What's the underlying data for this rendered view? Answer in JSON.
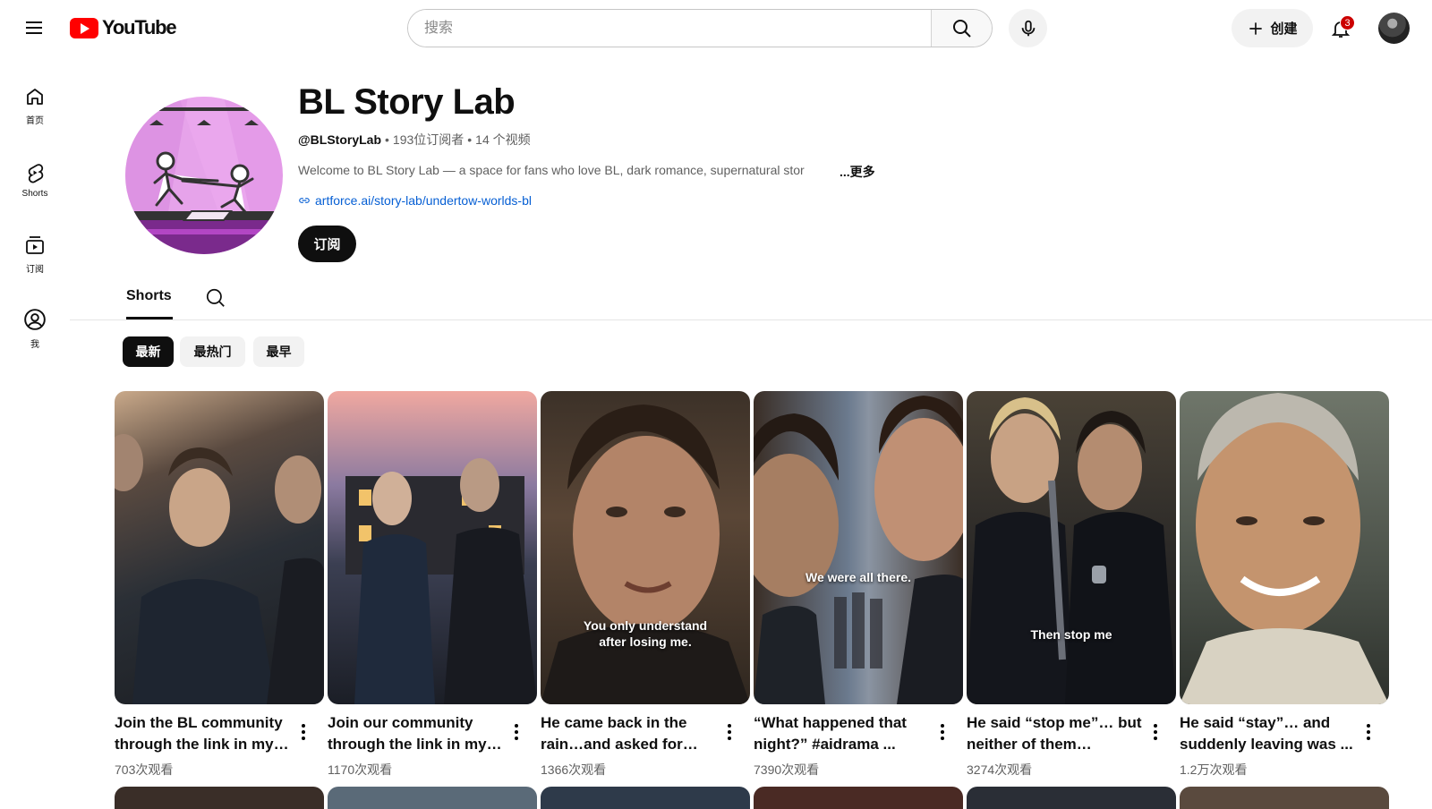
{
  "header": {
    "logo_text": "YouTube",
    "search_placeholder": "搜索",
    "create_label": "创建",
    "notification_count": "3"
  },
  "guide": [
    {
      "label": "首页",
      "icon": "home-icon"
    },
    {
      "label": "Shorts",
      "icon": "shorts-icon"
    },
    {
      "label": "订阅",
      "icon": "subscriptions-icon"
    },
    {
      "label": "我",
      "icon": "you-icon"
    }
  ],
  "channel": {
    "name": "BL Story Lab",
    "handle": "@BLStoryLab",
    "subscribers": "193位订阅者",
    "videos": "14 个视频",
    "description": "Welcome to BL Story Lab — a space for fans who love BL, dark romance, supernatural stor",
    "more": "...更多",
    "link": "artforce.ai/story-lab/undertow-worlds-bl",
    "subscribe_label": "订阅"
  },
  "tabs": {
    "shorts": "Shorts"
  },
  "chips": [
    {
      "label": "最新",
      "active": true
    },
    {
      "label": "最热门",
      "active": false
    },
    {
      "label": "最早",
      "active": false
    }
  ],
  "shorts": [
    {
      "title": "Join the BL community through the link in my ...",
      "views": "703次观看",
      "caption": ""
    },
    {
      "title": "Join our community through the link in my ...",
      "views": "1170次观看",
      "caption": ""
    },
    {
      "title": "He came back in the rain…and asked for one…",
      "views": "1366次观看",
      "caption": "You only understand\nafter losing me."
    },
    {
      "title": "“What happened that night?” #aidrama ...",
      "views": "7390次观看",
      "caption": "We were all there."
    },
    {
      "title": "He said “stop me”… but neither of them wanted…",
      "views": "3274次观看",
      "caption": "Then stop me"
    },
    {
      "title": "He said “stay”… and suddenly leaving was ...",
      "views": "1.2万次观看",
      "caption": ""
    }
  ]
}
